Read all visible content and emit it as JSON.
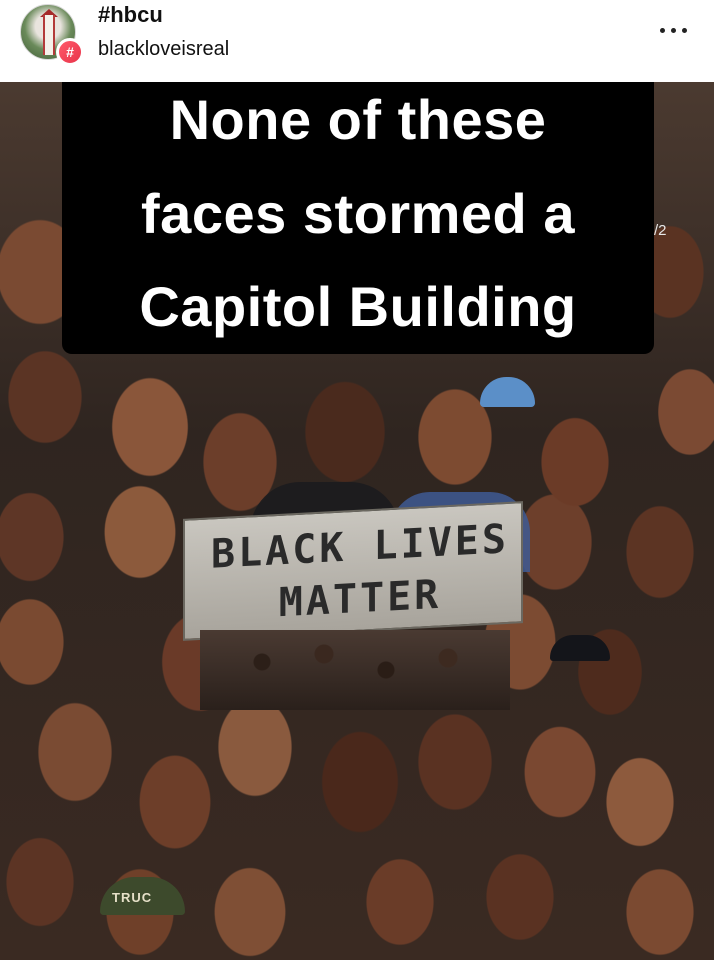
{
  "post_header": {
    "hashtag": "#hbcu",
    "username": "blackloveisreal",
    "badge_glyph": "#",
    "more_icon": "more-horizontal-icon"
  },
  "post_image": {
    "headline_lines": [
      "None of these",
      "faces stormed a",
      "Capitol Building"
    ],
    "banner_lines": [
      "BLACK LIVES",
      "MATTER"
    ],
    "cap_text": "TRUC",
    "side_number": "/2"
  },
  "colors": {
    "headline_bg": "#000000",
    "headline_text": "#ffffff",
    "badge": "#e8334a"
  }
}
